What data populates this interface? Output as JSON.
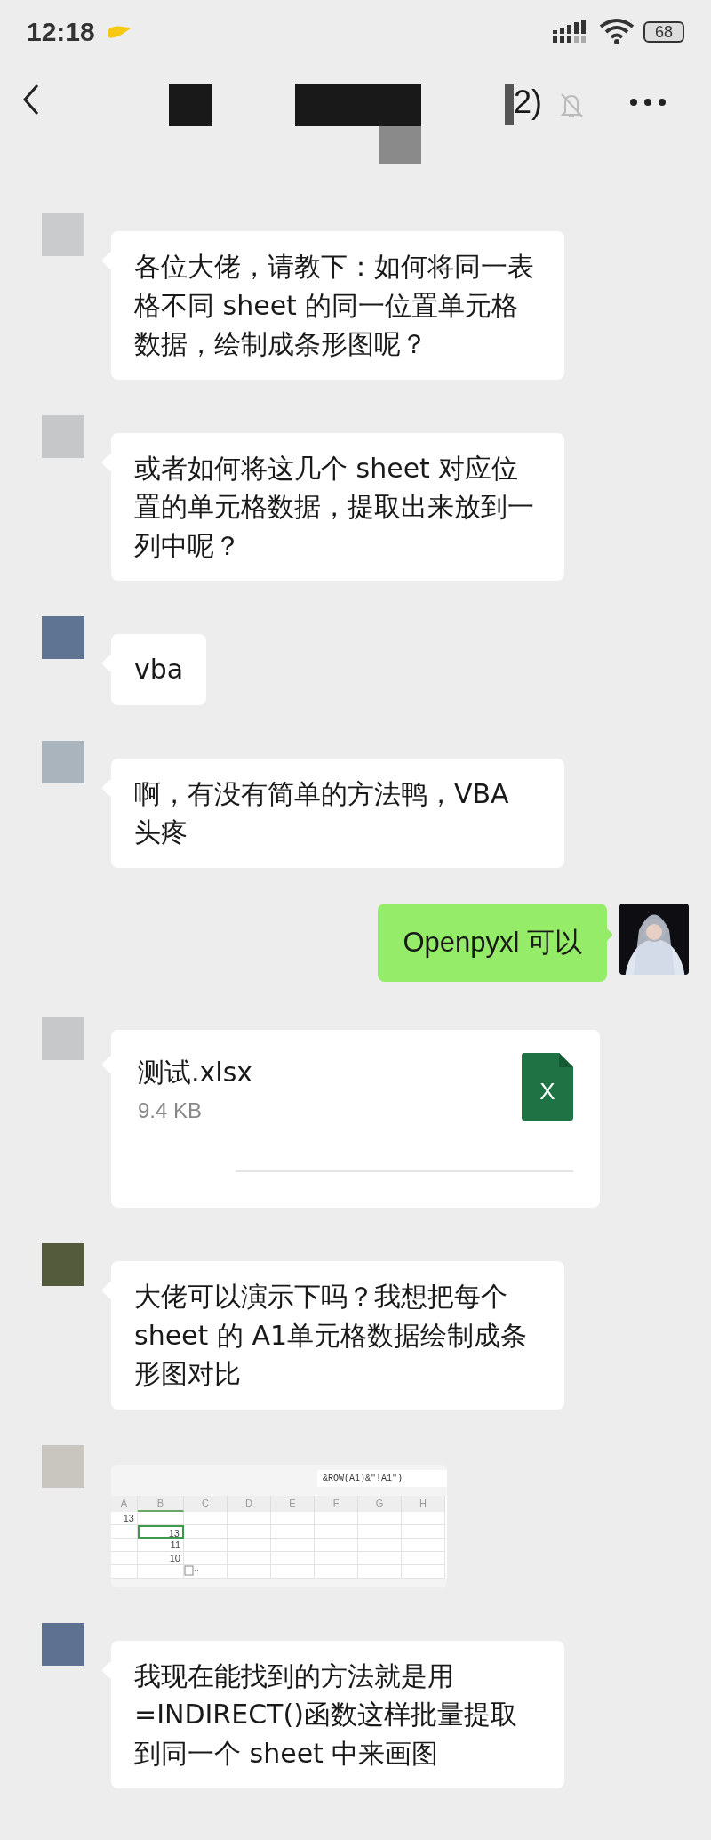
{
  "status_bar": {
    "time": "12:18",
    "battery": "68"
  },
  "nav_bar": {
    "title_fragment": "2)"
  },
  "messages": [
    {
      "kind": "text",
      "outgoing": false,
      "text": "各位大佬，请教下：如何将同一表格不同 sheet 的同一位置单元格数据，绘制成条形图呢？"
    },
    {
      "kind": "text",
      "outgoing": false,
      "text": "或者如何将这几个 sheet 对应位置的单元格数据，提取出来放到一列中呢？"
    },
    {
      "kind": "text",
      "outgoing": false,
      "text": "vba"
    },
    {
      "kind": "text",
      "outgoing": false,
      "text": "啊，有没有简单的方法鸭，VBA 头疼"
    },
    {
      "kind": "text",
      "outgoing": true,
      "text": "Openpyxl 可以"
    },
    {
      "kind": "file",
      "outgoing": false,
      "name": "测试.xlsx",
      "size": "9.4 KB",
      "badge": "X"
    },
    {
      "kind": "text",
      "outgoing": false,
      "text": "大佬可以演示下吗？我想把每个 sheet 的 A1单元格数据绘制成条形图对比"
    },
    {
      "outgoing": false,
      "formula": "&ROW(A1)&\"!A1\")",
      "columns": [
        "A",
        "B",
        "C",
        "D",
        "E",
        "F",
        "G",
        "H"
      ],
      "rows": [
        {
          "a": "13",
          "b": "",
          "selected": false
        },
        {
          "a": "",
          "b": "13",
          "selected": true
        },
        {
          "a": "",
          "b": "11",
          "selected": false
        },
        {
          "a": "",
          "b": "10",
          "selected": false
        }
      ]
    },
    {
      "kind": "text",
      "outgoing": false,
      "text": "我现在能找到的方法就是用=INDIRECT()函数这样批量提取到同一个 sheet 中来画图"
    }
  ]
}
